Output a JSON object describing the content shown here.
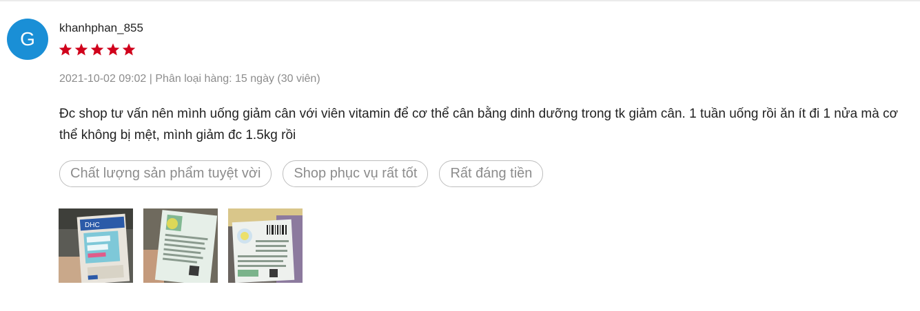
{
  "review": {
    "avatar_letter": "G",
    "username": "khanhphan_855",
    "rating": 5,
    "rating_max": 5,
    "star_color": "#d0011b",
    "avatar_color": "#1a8fd6",
    "meta": "2021-10-02 09:02 | Phân loại hàng: 15 ngày (30 viên)",
    "text": "Đc shop tư vấn nên mình uống giảm cân với viên vitamin để cơ thể cân bằng dinh dưỡng trong tk giảm cân. 1 tuần uống rồi ăn ít đi 1 nửa mà cơ thể không bị mệt, mình giảm đc 1.5kg rồi",
    "tags": [
      "Chất lượng sản phẩm tuyệt vời",
      "Shop phục vụ rất tốt",
      "Rất đáng tiền"
    ],
    "photos": [
      {
        "label": "DHC"
      },
      {
        "label": ""
      },
      {
        "label": ""
      }
    ]
  }
}
